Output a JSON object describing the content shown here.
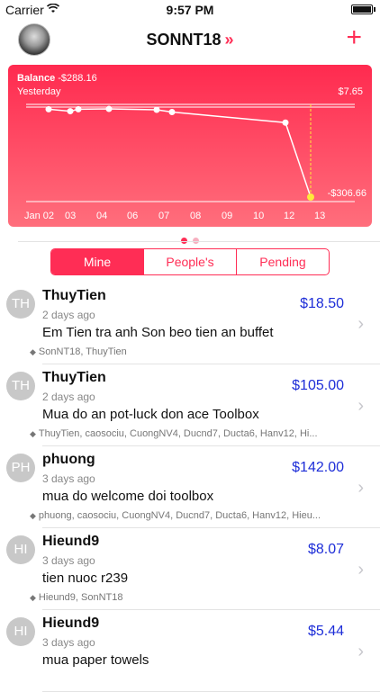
{
  "status_bar": {
    "carrier": "Carrier",
    "time": "9:57 PM"
  },
  "nav": {
    "title": "SONNT18",
    "title_chevron": "»",
    "add_label": "+"
  },
  "balance_card": {
    "balance_label": "Balance",
    "balance_value": "-$288.16",
    "yesterday_label": "Yesterday",
    "top_value": "$7.65",
    "end_value": "-$306.66",
    "x_ticks": [
      "Jan 02",
      "03",
      "04",
      "06",
      "07",
      "08",
      "09",
      "10",
      "12",
      "13"
    ],
    "colors": {
      "card_top": "#ff2a4f",
      "card_bottom": "#ff6e7c",
      "highlight_point": "#ffea3b"
    }
  },
  "chart_data": {
    "type": "line",
    "x": [
      "Jan 02",
      "03",
      "04",
      "06",
      "07",
      "08",
      "09",
      "10",
      "12",
      "13"
    ],
    "series": [
      {
        "values": [
          2,
          -5,
          2,
          3,
          0,
          -8,
          null,
          null,
          -45,
          -306.66
        ]
      }
    ],
    "annotations": [
      "$7.65",
      "-$306.66"
    ]
  },
  "pager": {
    "pages": 2,
    "active": 0,
    "active_color": "#ff2d55",
    "inactive_color": "#f7b0c0"
  },
  "segments": [
    {
      "label": "Mine",
      "active": true
    },
    {
      "label": "People's",
      "active": false
    },
    {
      "label": "Pending",
      "active": false
    }
  ],
  "transactions": [
    {
      "initials": "TH",
      "name": "ThuyTien",
      "time": "2 days ago",
      "desc": "Em Tien tra anh Son beo tien an buffet",
      "tags": "SonNT18, ThuyTien",
      "amount": "$18.50"
    },
    {
      "initials": "TH",
      "name": "ThuyTien",
      "time": "2 days ago",
      "desc": "Mua do an pot-luck don ace Toolbox",
      "tags": "ThuyTien, caosociu, CuongNV4, Ducnd7, Ducta6, Hanv12, Hi...",
      "amount": "$105.00"
    },
    {
      "initials": "PH",
      "name": "phuong",
      "time": "3 days ago",
      "desc": "mua do welcome doi toolbox",
      "tags": "phuong, caosociu, CuongNV4, Ducnd7, Ducta6, Hanv12, Hieu...",
      "amount": "$142.00"
    },
    {
      "initials": "HI",
      "name": "Hieund9",
      "time": "3 days ago",
      "desc": "tien nuoc r239",
      "tags": "Hieund9, SonNT18",
      "amount": "$8.07"
    },
    {
      "initials": "HI",
      "name": "Hieund9",
      "time": "3 days ago",
      "desc": "mua paper towels",
      "tags": "",
      "amount": "$5.44"
    }
  ]
}
